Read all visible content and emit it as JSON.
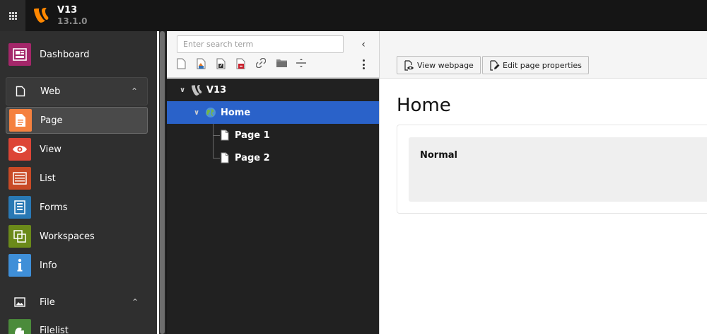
{
  "topbar": {
    "apps_icon": "grid-9-icon",
    "logo_icon": "typo3-logo-icon",
    "site_name": "V13",
    "version": "13.1.0",
    "brand_color": "#ff8700"
  },
  "module_menu": {
    "dashboard": {
      "label": "Dashboard",
      "icon": "dashboard-icon",
      "color": "#a4276a"
    },
    "web_group": {
      "label": "Web",
      "icon": "document-icon",
      "expanded": true
    },
    "web_items": [
      {
        "label": "Page",
        "icon": "page-module-icon",
        "color": "#f5813f",
        "active": true
      },
      {
        "label": "View",
        "icon": "eye-icon",
        "color": "#dd4536"
      },
      {
        "label": "List",
        "icon": "list-icon",
        "color": "#c94a26"
      },
      {
        "label": "Forms",
        "icon": "form-icon",
        "color": "#2979b5"
      },
      {
        "label": "Workspaces",
        "icon": "workspaces-icon",
        "color": "#6b8a1a"
      },
      {
        "label": "Info",
        "icon": "info-icon",
        "color": "#3f8fd8"
      }
    ],
    "file_group": {
      "label": "File",
      "icon": "image-icon",
      "expanded": true
    },
    "file_items": [
      {
        "label": "Filelist",
        "icon": "filelist-icon",
        "color": "#4b8b3b"
      }
    ]
  },
  "page_tree": {
    "search_placeholder": "Enter search term",
    "toolbar_icons": [
      "new-page-icon",
      "page-shortcut-icon",
      "page-link-icon",
      "page-backend-icon",
      "external-link-icon",
      "folder-icon",
      "divider-icon"
    ],
    "nodes": [
      {
        "label": "V13",
        "icon": "typo3-root-icon",
        "expanded": true
      },
      {
        "label": "Home",
        "icon": "globe-icon",
        "expanded": true,
        "selected": true
      },
      {
        "label": "Page 1",
        "icon": "page-icon"
      },
      {
        "label": "Page 2",
        "icon": "page-icon"
      }
    ]
  },
  "content": {
    "view_webpage_label": "View webpage",
    "edit_properties_label": "Edit page properties",
    "page_title": "Home",
    "column_title": "Normal"
  }
}
